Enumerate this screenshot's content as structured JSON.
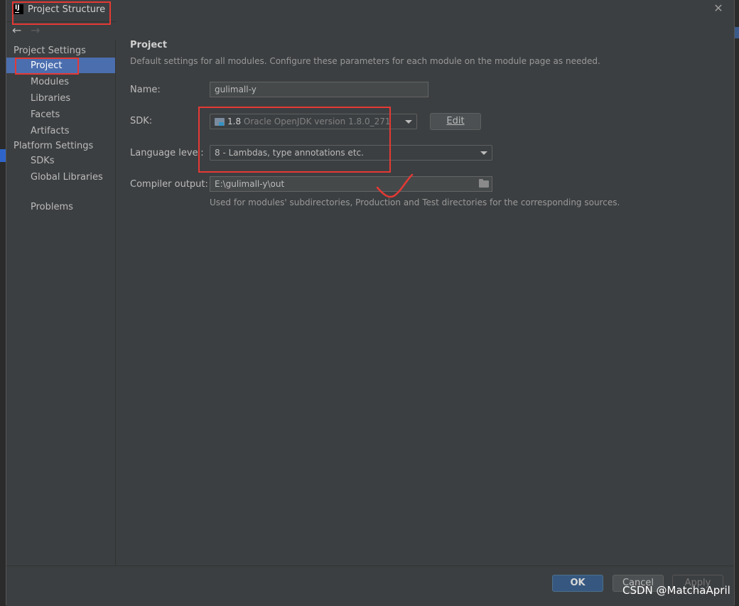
{
  "window": {
    "title": "Project Structure"
  },
  "nav": {
    "back": "←",
    "forward": "→"
  },
  "sidebar": {
    "project_settings_header": "Project Settings",
    "project_settings_items": [
      "Project",
      "Modules",
      "Libraries",
      "Facets",
      "Artifacts"
    ],
    "platform_settings_header": "Platform Settings",
    "platform_settings_items": [
      "SDKs",
      "Global Libraries"
    ],
    "problems": "Problems",
    "selected": "Project"
  },
  "content": {
    "title": "Project",
    "description": "Default settings for all modules. Configure these parameters for each module on the module page as needed.",
    "name_label": "Name:",
    "name_value": "gulimall-y",
    "sdk_label": "SDK:",
    "sdk_version": "1.8",
    "sdk_detail": "Oracle OpenJDK version 1.8.0_271",
    "sdk_edit": "Edit",
    "language_level_label": "Language level:",
    "language_level_value": "8 - Lambdas, type annotations etc.",
    "compiler_output_label": "Compiler output:",
    "compiler_output_value": "E:\\gulimall-y\\out",
    "compiler_output_hint": "Used for modules' subdirectories, Production and Test directories for the corresponding sources."
  },
  "footer": {
    "ok": "OK",
    "cancel": "Cancel",
    "apply": "Apply"
  },
  "watermark": "CSDN @MatchaApril",
  "colors": {
    "accent": "#4b6eaf",
    "annotation": "#e53935",
    "background": "#3c3f41"
  },
  "icons": [
    "app-icon",
    "close-icon",
    "back-arrow-icon",
    "forward-arrow-icon",
    "folder-icon",
    "chevron-down-icon",
    "browse-folder-icon"
  ]
}
